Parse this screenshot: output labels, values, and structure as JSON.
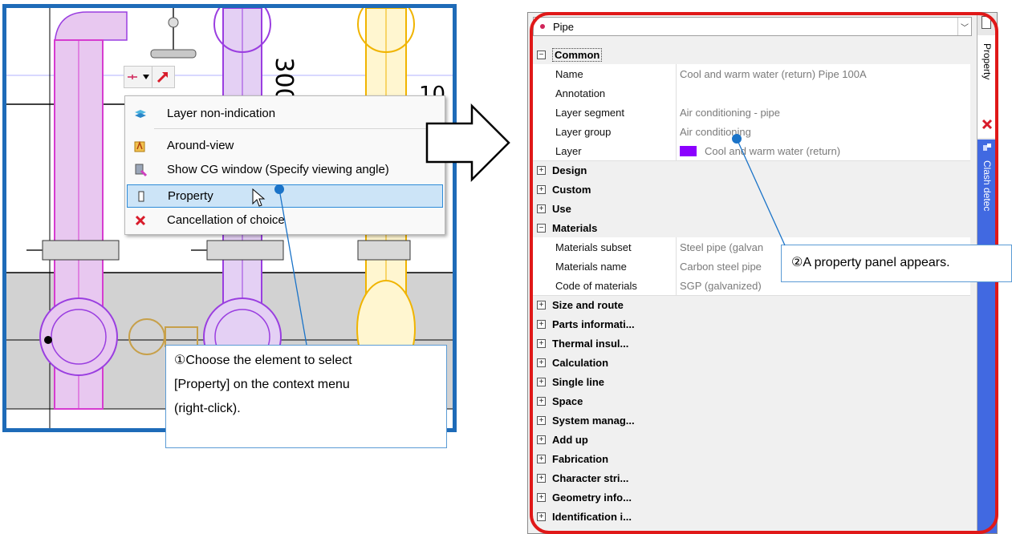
{
  "cad": {
    "dimension_text_1": "300",
    "dimension_text_2": "10"
  },
  "context_menu": {
    "items": [
      {
        "label": "Layer non-indication",
        "icon": "layer-icon"
      },
      {
        "label": "Around-view",
        "icon": "around-view-icon",
        "has_submenu": true
      },
      {
        "label": "Show CG window (Specify viewing angle)",
        "icon": "cg-window-icon"
      },
      {
        "label": "Property",
        "icon": "property-icon",
        "highlighted": true
      },
      {
        "label": "Cancellation of choice",
        "icon": "cancel-x-icon"
      }
    ]
  },
  "callouts": {
    "step1_lines": [
      "①Choose the element to select",
      "[Property] on the context menu",
      "(right-click)."
    ],
    "step2": "②A property panel appears."
  },
  "property_panel": {
    "object_selector": "Pipe",
    "side_tabs": {
      "property": "Property",
      "clash": "Clash detec"
    },
    "categories_top": [
      {
        "name": "Common",
        "expanded": true
      }
    ],
    "common_props": [
      {
        "key": "Name",
        "value": "Cool and warm water (return) Pipe 100A"
      },
      {
        "key": "Annotation",
        "value": ""
      },
      {
        "key": "Layer segment",
        "value": "Air conditioning - pipe"
      },
      {
        "key": "Layer group",
        "value": "Air conditioning"
      },
      {
        "key": "Layer",
        "value": "Cool and warm water (return)",
        "swatch": "#8b00ff"
      }
    ],
    "categories_mid": [
      "Design",
      "Custom",
      "Use"
    ],
    "materials": {
      "name": "Materials",
      "props": [
        {
          "key": "Materials subset",
          "value": "Steel pipe (galvan"
        },
        {
          "key": "Materials name",
          "value": "Carbon steel pipe"
        },
        {
          "key": "Code of materials",
          "value": "SGP (galvanized)"
        }
      ]
    },
    "categories_bottom": [
      "Size and route",
      "Parts informati...",
      "Thermal insul...",
      "Calculation",
      "Single line",
      "Space",
      "System manag...",
      "Add up",
      "Fabrication",
      "Character stri...",
      "Geometry info...",
      "Identification i..."
    ]
  },
  "colors": {
    "highlight_frame": "#e01818",
    "cad_frame": "#1e6bb8",
    "callout_line": "#1a73c8",
    "menu_highlight": "#cce4f7",
    "pipe_magenta": "#d63cd0",
    "pipe_purple": "#9a3ee0",
    "pipe_yellow": "#f0b400"
  }
}
